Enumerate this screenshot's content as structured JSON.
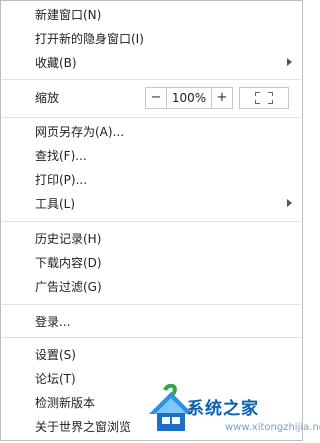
{
  "menu": {
    "items": [
      {
        "label": "新建窗口(N)"
      },
      {
        "label": "打开新的隐身窗口(I)"
      },
      {
        "label": "收藏(B)"
      },
      {
        "label": "网页另存为(A)..."
      },
      {
        "label": "查找(F)..."
      },
      {
        "label": "打印(P)..."
      },
      {
        "label": "工具(L)"
      },
      {
        "label": "历史记录(H)"
      },
      {
        "label": "下载内容(D)"
      },
      {
        "label": "广告过滤(G)"
      },
      {
        "label": "登录..."
      },
      {
        "label": "设置(S)"
      },
      {
        "label": "论坛(T)"
      },
      {
        "label": "检测新版本"
      },
      {
        "label": "关于世界之窗浏览"
      }
    ],
    "zoom": {
      "label": "缩放",
      "minus": "−",
      "value": "100%",
      "plus": "+"
    }
  },
  "watermark": {
    "text": "系统之家",
    "url": "www.xitongzhijia.net"
  },
  "colors": {
    "separator": "#e1e1e1",
    "border": "#bdbdbd",
    "watermark_blue": "#0a5fb0"
  }
}
